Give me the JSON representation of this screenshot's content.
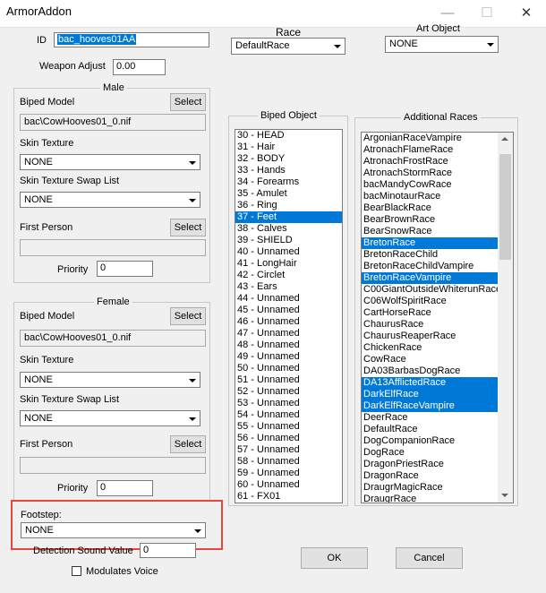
{
  "window": {
    "title": "ArmorAddon",
    "min": "—",
    "max": "☐",
    "close": "✕"
  },
  "id": {
    "label": "ID",
    "value": "bac_hooves01AA"
  },
  "race": {
    "label": "Race",
    "value": "DefaultRace"
  },
  "art_object": {
    "label": "Art Object",
    "value": "NONE"
  },
  "weapon_adjust": {
    "label": "Weapon Adjust",
    "value": "0.00"
  },
  "male": {
    "group_label": "Male",
    "biped_model_label": "Biped Model",
    "select_label": "Select",
    "biped_model_value": "bac\\CowHooves01_0.nif",
    "skin_texture_label": "Skin Texture",
    "skin_texture_value": "NONE",
    "swap_list_label": "Skin Texture Swap List",
    "swap_list_value": "NONE",
    "first_person_label": "First Person",
    "first_person_select_label": "Select",
    "first_person_value": "",
    "priority_label": "Priority",
    "priority_value": "0"
  },
  "female": {
    "group_label": "Female",
    "biped_model_label": "Biped Model",
    "select_label": "Select",
    "biped_model_value": "bac\\CowHooves01_0.nif",
    "skin_texture_label": "Skin Texture",
    "skin_texture_value": "NONE",
    "swap_list_label": "Skin Texture Swap List",
    "swap_list_value": "NONE",
    "first_person_label": "First Person",
    "first_person_select_label": "Select",
    "first_person_value": "",
    "priority_label": "Priority",
    "priority_value": "0"
  },
  "footstep": {
    "label": "Footstep:",
    "value": "NONE"
  },
  "detection": {
    "label": "Detection Sound Value",
    "value": "0"
  },
  "modulates": {
    "label": "Modulates Voice",
    "checked": false
  },
  "biped_object": {
    "label": "Biped Object",
    "items": [
      {
        "text": "30 - HEAD",
        "selected": false
      },
      {
        "text": "31 - Hair",
        "selected": false
      },
      {
        "text": "32 - BODY",
        "selected": false
      },
      {
        "text": "33 - Hands",
        "selected": false
      },
      {
        "text": "34 - Forearms",
        "selected": false
      },
      {
        "text": "35 - Amulet",
        "selected": false
      },
      {
        "text": "36 - Ring",
        "selected": false
      },
      {
        "text": "37 - Feet",
        "selected": true
      },
      {
        "text": "38 - Calves",
        "selected": false
      },
      {
        "text": "39 - SHIELD",
        "selected": false
      },
      {
        "text": "40 - Unnamed",
        "selected": false
      },
      {
        "text": "41 - LongHair",
        "selected": false
      },
      {
        "text": "42 - Circlet",
        "selected": false
      },
      {
        "text": "43 - Ears",
        "selected": false
      },
      {
        "text": "44 - Unnamed",
        "selected": false
      },
      {
        "text": "45 - Unnamed",
        "selected": false
      },
      {
        "text": "46 - Unnamed",
        "selected": false
      },
      {
        "text": "47 - Unnamed",
        "selected": false
      },
      {
        "text": "48 - Unnamed",
        "selected": false
      },
      {
        "text": "49 - Unnamed",
        "selected": false
      },
      {
        "text": "50 - Unnamed",
        "selected": false
      },
      {
        "text": "51 - Unnamed",
        "selected": false
      },
      {
        "text": "52 - Unnamed",
        "selected": false
      },
      {
        "text": "53 - Unnamed",
        "selected": false
      },
      {
        "text": "54 - Unnamed",
        "selected": false
      },
      {
        "text": "55 - Unnamed",
        "selected": false
      },
      {
        "text": "56 - Unnamed",
        "selected": false
      },
      {
        "text": "57 - Unnamed",
        "selected": false
      },
      {
        "text": "58 - Unnamed",
        "selected": false
      },
      {
        "text": "59 - Unnamed",
        "selected": false
      },
      {
        "text": "60 - Unnamed",
        "selected": false
      },
      {
        "text": "61 - FX01",
        "selected": false
      }
    ]
  },
  "additional_races": {
    "label": "Additional Races",
    "items": [
      {
        "text": "ArgonianRaceVampire",
        "selected": false
      },
      {
        "text": "AtronachFlameRace",
        "selected": false
      },
      {
        "text": "AtronachFrostRace",
        "selected": false
      },
      {
        "text": "AtronachStormRace",
        "selected": false
      },
      {
        "text": "bacMandyCowRace",
        "selected": false
      },
      {
        "text": "bacMinotaurRace",
        "selected": false
      },
      {
        "text": "BearBlackRace",
        "selected": false
      },
      {
        "text": "BearBrownRace",
        "selected": false
      },
      {
        "text": "BearSnowRace",
        "selected": false
      },
      {
        "text": "BretonRace",
        "selected": true
      },
      {
        "text": "BretonRaceChild",
        "selected": false
      },
      {
        "text": "BretonRaceChildVampire",
        "selected": false
      },
      {
        "text": "BretonRaceVampire",
        "selected": true
      },
      {
        "text": "C00GiantOutsideWhiterunRace",
        "selected": false
      },
      {
        "text": "C06WolfSpiritRace",
        "selected": false
      },
      {
        "text": "CartHorseRace",
        "selected": false
      },
      {
        "text": "ChaurusRace",
        "selected": false
      },
      {
        "text": "ChaurusReaperRace",
        "selected": false
      },
      {
        "text": "ChickenRace",
        "selected": false
      },
      {
        "text": "CowRace",
        "selected": false
      },
      {
        "text": "DA03BarbasDogRace",
        "selected": false
      },
      {
        "text": "DA13AfflictedRace",
        "selected": true
      },
      {
        "text": "DarkElfRace",
        "selected": true
      },
      {
        "text": "DarkElfRaceVampire",
        "selected": true
      },
      {
        "text": "DeerRace",
        "selected": false
      },
      {
        "text": "DefaultRace",
        "selected": false
      },
      {
        "text": "DogCompanionRace",
        "selected": false
      },
      {
        "text": "DogRace",
        "selected": false
      },
      {
        "text": "DragonPriestRace",
        "selected": false
      },
      {
        "text": "DragonRace",
        "selected": false
      },
      {
        "text": "DraugrMagicRace",
        "selected": false
      },
      {
        "text": "DraugrRace",
        "selected": false
      }
    ]
  },
  "buttons": {
    "ok": "OK",
    "cancel": "Cancel"
  }
}
